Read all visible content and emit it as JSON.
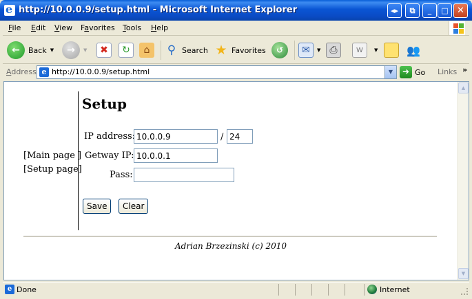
{
  "window": {
    "title": "http://10.0.0.9/setup.html - Microsoft Internet Explorer"
  },
  "menu": [
    {
      "key": "F",
      "rest": "ile"
    },
    {
      "key": "E",
      "rest": "dit"
    },
    {
      "key": "V",
      "rest": "iew"
    },
    {
      "key": "a",
      "pre": "F",
      "rest": "vorites"
    },
    {
      "key": "T",
      "rest": "ools"
    },
    {
      "key": "H",
      "rest": "elp"
    }
  ],
  "toolbar": {
    "back_label": "Back",
    "search_label": "Search",
    "favorites_label": "Favorites"
  },
  "address": {
    "label": "Address",
    "url": "http://10.0.0.9/setup.html",
    "go_label": "Go",
    "links_label": "Links"
  },
  "page": {
    "nav_main": "[Main page ]",
    "nav_setup": "[Setup page]",
    "heading": "Setup",
    "ip_label": "IP address:",
    "ip_value": "10.0.0.9",
    "mask_separator": "/",
    "mask_value": "24",
    "gateway_label": "Getway IP:",
    "gateway_value": "10.0.0.1",
    "pass_label": "Pass:",
    "pass_value": "",
    "save_label": "Save",
    "clear_label": "Clear",
    "footer": "Adrian Brzezinski (c) 2010"
  },
  "status": {
    "text": "Done",
    "zone": "Internet"
  },
  "colors": {
    "titlebar": "#0a55d4",
    "chrome": "#ece9d8",
    "content": "#ffffff"
  }
}
